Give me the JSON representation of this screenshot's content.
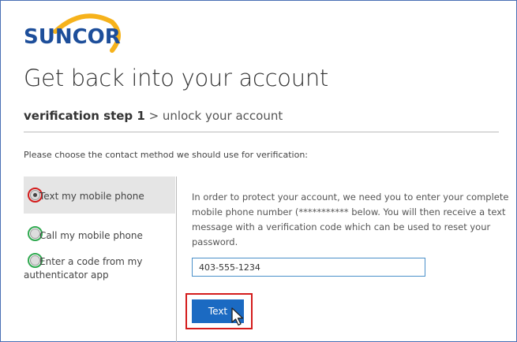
{
  "brand": {
    "name": "SUNCOR",
    "text_color": "#1d4e9a",
    "arc_color": "#f6b21b"
  },
  "header": {
    "title": "Get back into your account",
    "breadcrumb_step": "verification step 1",
    "breadcrumb_rest": " > unlock your account"
  },
  "prompt": "Please choose the contact method we should use for verification:",
  "methods": [
    {
      "label": "Text my mobile phone",
      "selected": true
    },
    {
      "label": "Call my mobile phone",
      "selected": false
    },
    {
      "label_line1": "Enter a code from my",
      "label_line2": "authenticator app",
      "selected": false
    }
  ],
  "info_text": "In order to protect your account, we need you to enter your complete mobile phone number (***********        below. You will then receive a text message with a verification code which can be used to reset your password.",
  "phone_input": {
    "value": "403-555-1234"
  },
  "submit_button": {
    "label": "Text",
    "color": "#1b6ac2"
  },
  "highlights": {
    "selected_color": "#d41c1c",
    "other_color": "#2fa84f"
  }
}
